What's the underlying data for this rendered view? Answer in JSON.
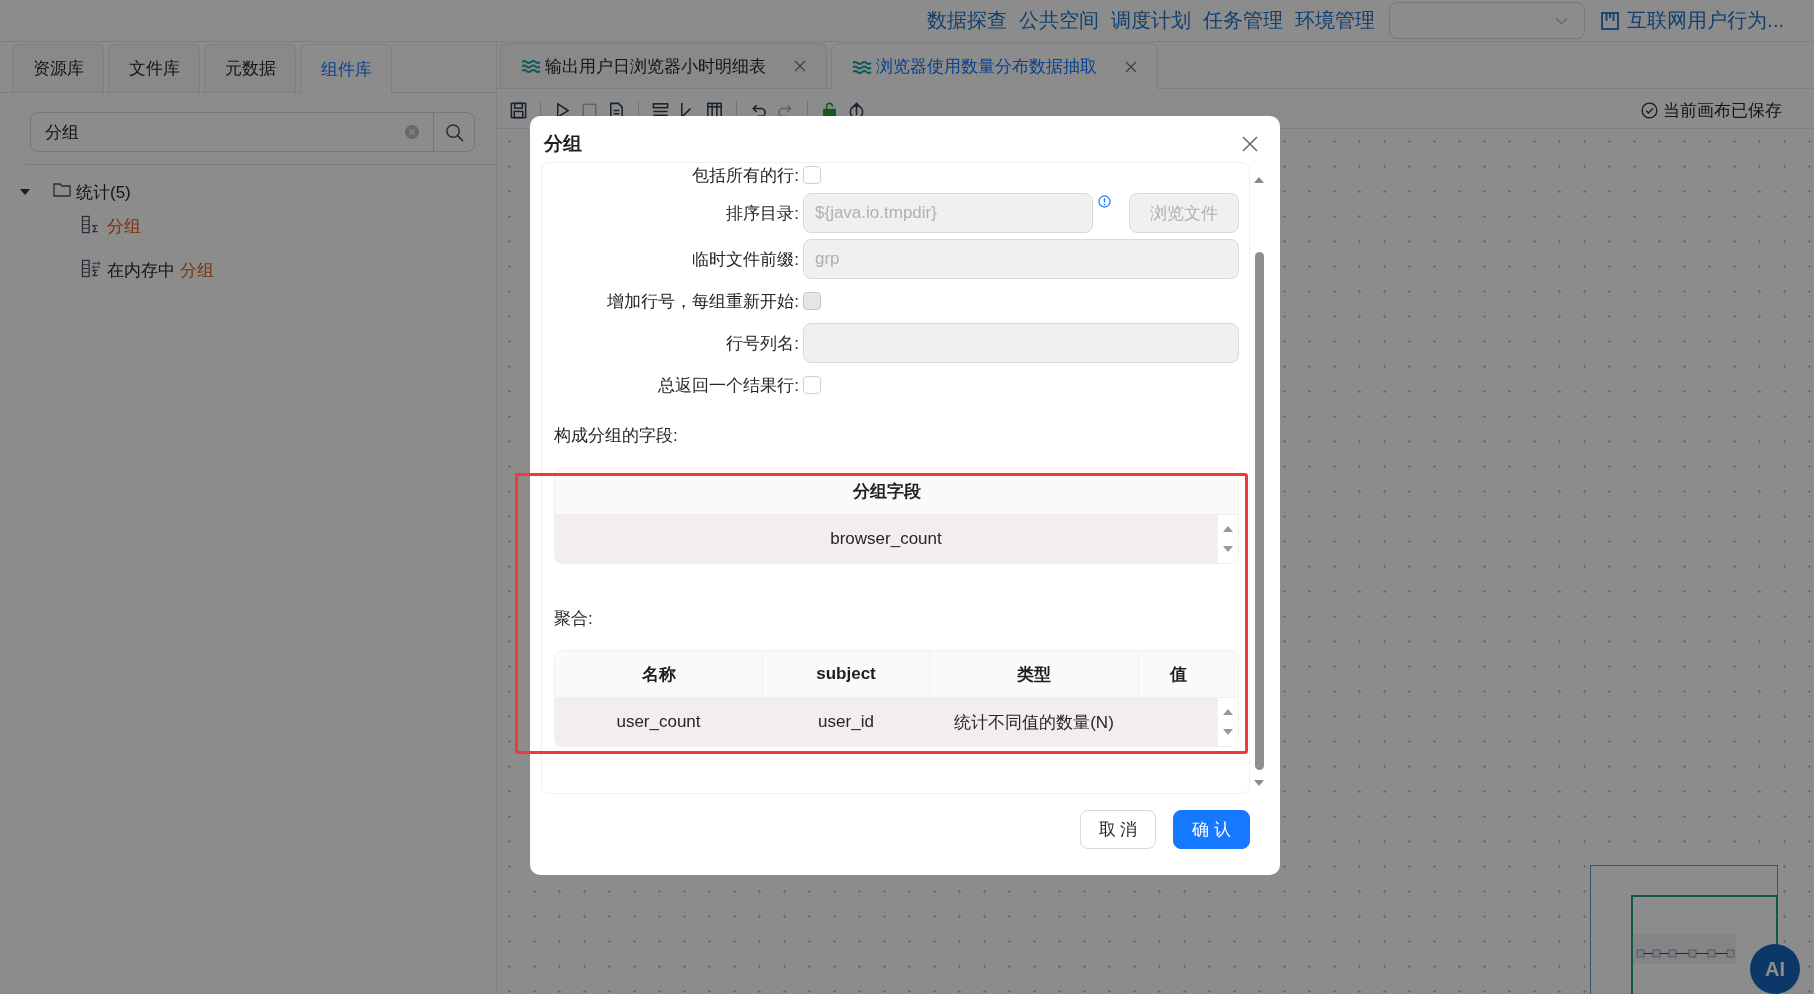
{
  "top_nav": {
    "links": [
      "数据探查",
      "公共空间",
      "调度计划",
      "任务管理",
      "环境管理"
    ],
    "project": "互联网用户行为..."
  },
  "left_panel": {
    "tabs": [
      {
        "label": "资源库",
        "selected": false
      },
      {
        "label": "文件库",
        "selected": false
      },
      {
        "label": "元数据",
        "selected": false
      },
      {
        "label": "组件库",
        "selected": true
      }
    ],
    "search": {
      "value": "分组"
    },
    "tree": [
      {
        "label": "统计(5)",
        "expanded": true,
        "children": [
          {
            "kind": "group",
            "match": "分组"
          },
          {
            "kind": "memory_group",
            "text": "在内存中",
            "match": "分组"
          }
        ]
      }
    ]
  },
  "editor_tabs": [
    {
      "label": "输出用户日浏览器小时明细表",
      "selected": false
    },
    {
      "label": "浏览器使用数量分布数据抽取",
      "selected": true
    }
  ],
  "toolbar": {
    "groups": [
      [
        {
          "kind": "save",
          "disabled": false
        }
      ],
      [
        {
          "kind": "run",
          "disabled": false
        },
        {
          "kind": "stop",
          "disabled": true
        },
        {
          "kind": "debug",
          "disabled": false
        }
      ],
      [
        {
          "kind": "align",
          "disabled": false
        },
        {
          "kind": "ruler",
          "disabled": false
        },
        {
          "kind": "grid",
          "disabled": false
        }
      ],
      [
        {
          "kind": "undo",
          "disabled": false
        },
        {
          "kind": "redo",
          "disabled": true
        }
      ],
      [
        {
          "kind": "lock",
          "disabled": false
        },
        {
          "kind": "upload",
          "disabled": false
        }
      ]
    ],
    "status": "当前画布已保存"
  },
  "dialog": {
    "title": "分组",
    "fields": [
      {
        "kind": "checkbox",
        "label": "包括所有的行:",
        "checked": false,
        "disabled": false
      },
      {
        "kind": "path",
        "label": "排序目录:",
        "value": "${java.io.tmpdir}",
        "disabled": true,
        "button": {
          "label": "浏览文件",
          "disabled": true
        }
      },
      {
        "kind": "text",
        "label": "临时文件前缀:",
        "value": "grp",
        "disabled": true
      },
      {
        "kind": "checkbox",
        "label": "增加行号，每组重新开始:",
        "checked": false,
        "disabled": true
      },
      {
        "kind": "text",
        "label": "行号列名:",
        "disabled": true
      },
      {
        "kind": "checkbox",
        "label": "总返回一个结果行:",
        "checked": false,
        "disabled": false
      }
    ],
    "group_table": {
      "label": "构成分组的字段:",
      "columns": [
        "分组字段"
      ],
      "rows": [
        {
          "cells": [
            "browser_count"
          ],
          "selected": true
        }
      ]
    },
    "aggregate_table": {
      "label": "聚合:",
      "columns": [
        "名称",
        "subject",
        "类型",
        "值"
      ],
      "rows": [
        {
          "cells": [
            "user_count",
            "user_id",
            "统计不同值的数量(N)"
          ],
          "selected": true
        }
      ]
    },
    "buttons": [
      {
        "label": "取 消",
        "kind": "default"
      },
      {
        "label": "确 认",
        "kind": "primary"
      }
    ]
  },
  "ai_button": {
    "label": "AI"
  }
}
